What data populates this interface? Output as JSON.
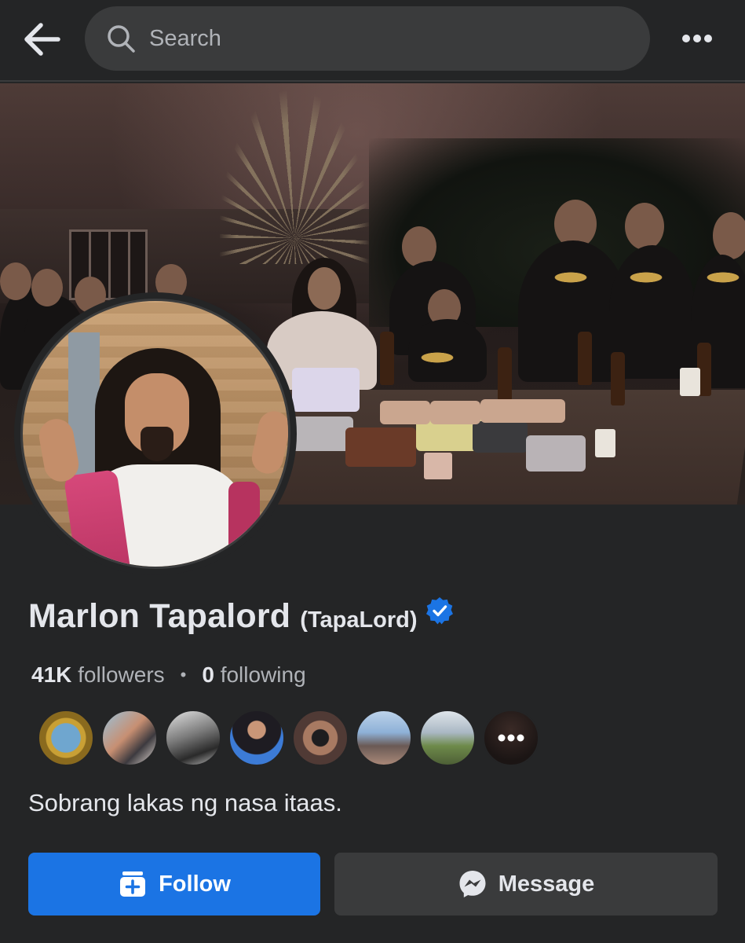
{
  "header": {
    "search_placeholder": "Search",
    "back_icon": "arrow-left-icon",
    "search_icon": "magnifier-icon",
    "more_icon": "ellipsis-horizontal-icon"
  },
  "profile": {
    "name": "Marlon Tapalord",
    "alternate_name": "(TapaLord)",
    "verified": true,
    "followers_count": "41K",
    "followers_label": "followers",
    "separator": "•",
    "following_count": "0",
    "following_label": "following",
    "bio": "Sobrang lakas ng nasa itaas."
  },
  "mutual_friends": {
    "visible_count": 7,
    "more_icon": "ellipsis-horizontal-icon"
  },
  "actions": {
    "follow_label": "Follow",
    "message_label": "Message",
    "follow_icon": "add-friend-icon",
    "message_icon": "messenger-icon"
  },
  "colors": {
    "background": "#242526",
    "primary": "#1b74e4",
    "secondary_button": "#3a3b3c",
    "verified_badge": "#1b74e4",
    "text_primary": "#e4e6eb",
    "text_secondary": "#b0b3b8"
  }
}
